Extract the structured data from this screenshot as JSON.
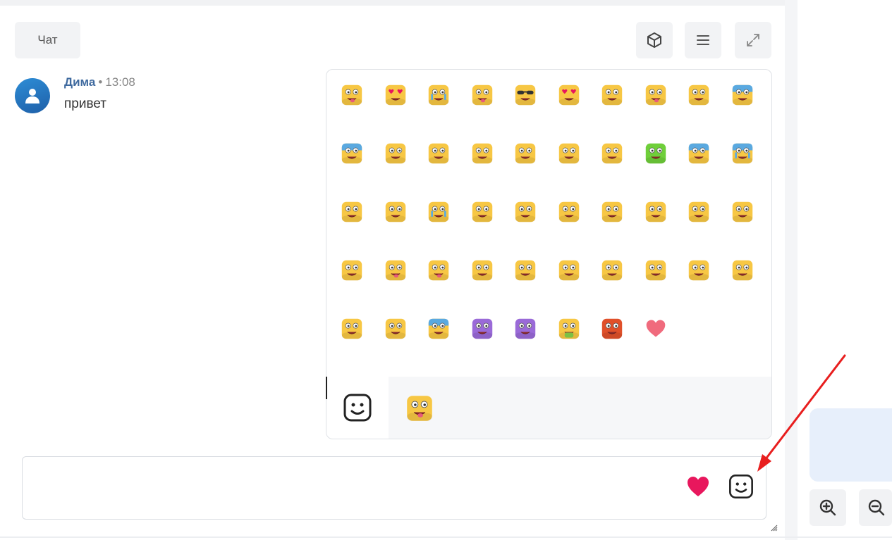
{
  "header": {
    "chat_tab_label": "Чат",
    "toolbar_icons": [
      "cube-icon",
      "menu-icon",
      "expand-icon"
    ]
  },
  "message": {
    "author": "Дима",
    "separator": "•",
    "time": "13:08",
    "text": "привет",
    "avatar_icon": "user-icon"
  },
  "emoji_picker": {
    "category_icon": "smiley-category-icon",
    "recent_emoji": "silly-tongue-face",
    "emojis": [
      "silly-face",
      "heart-eyes",
      "tearful-face",
      "winking-tongue",
      "sunglasses",
      "heart-eyes-red",
      "grinning-teeth",
      "tongue-face",
      "neutral-dots",
      "shocked-face",
      "grimacing-blue",
      "strained-face",
      "unamused-face",
      "dizzy-face",
      "gritted-face",
      "laughing-face",
      "bruised-face",
      "green-alien",
      "worried-face",
      "crying-face",
      "winking-face",
      "surprised-face",
      "tears-of-joy",
      "smirking-face",
      "kissing-heart",
      "relieved-face",
      "content-face",
      "grinning-squint",
      "amazed-face",
      "blushing-smile",
      "expressionless",
      "dead-tongue",
      "squinting-tongue",
      "sad-face",
      "confounded-face",
      "masked-face",
      "sleepy-smirk",
      "disappointed-face",
      "meh-face",
      "sleeping-face",
      "angry-squint",
      "frowning-face",
      "fearful-face",
      "purple-face",
      "purple-smile",
      "nauseated-face",
      "red-angry",
      "heart"
    ]
  },
  "composer": {
    "heart_icon": "heart-icon",
    "emoji_button_icon": "smiley-icon"
  },
  "sidebar": {
    "zoom_in_icon": "zoom-in-icon",
    "zoom_out_icon": "zoom-out-icon"
  },
  "colors": {
    "author": "#3f6a9f",
    "emoji_yellow": "#f7c744",
    "heart": "#e8175d",
    "arrow": "#e81e1e",
    "side_card": "#e7effb"
  }
}
